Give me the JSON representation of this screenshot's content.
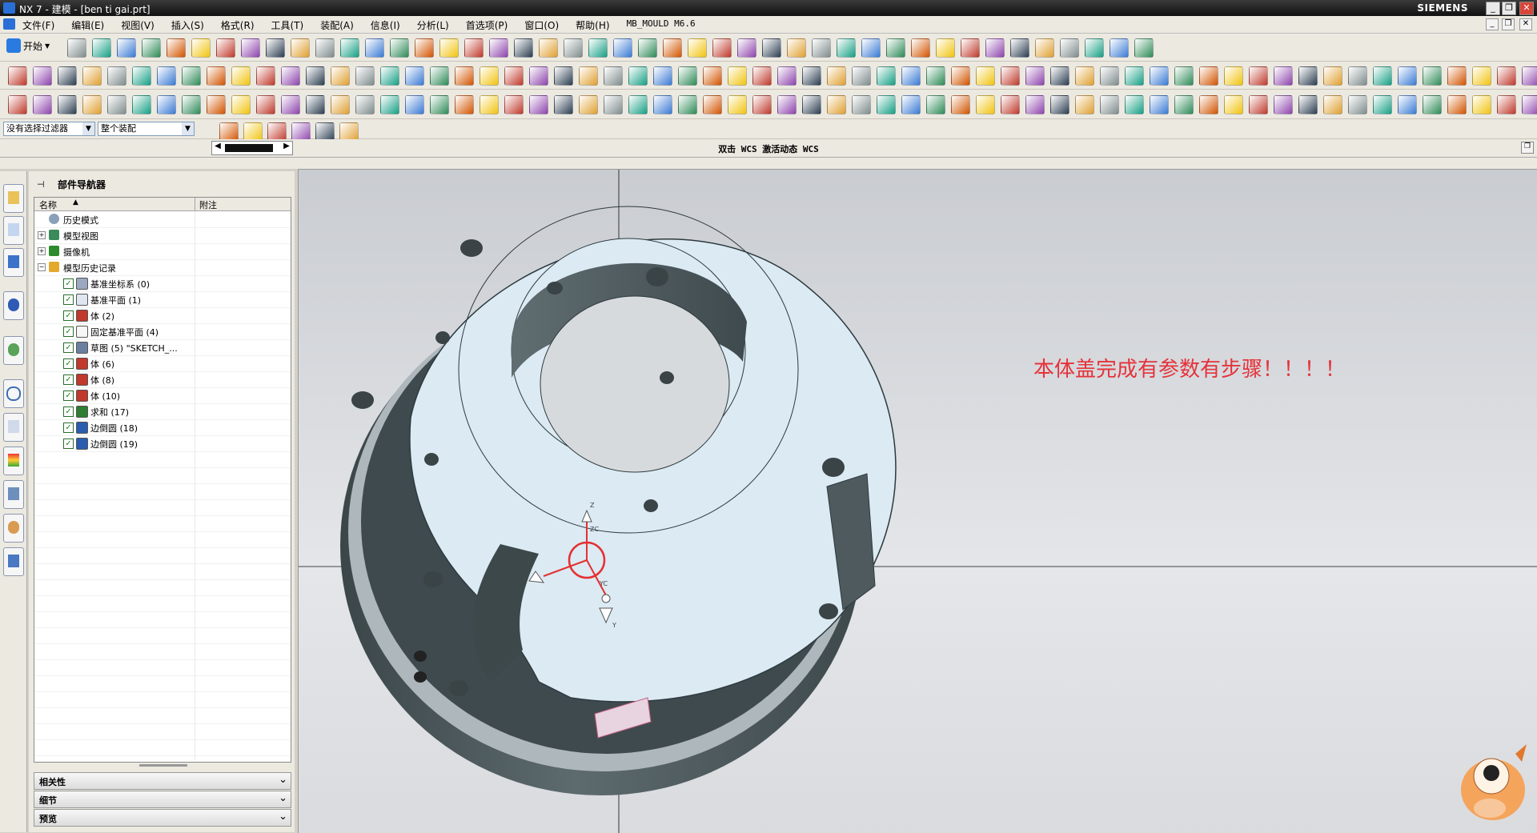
{
  "window": {
    "title": "NX 7 - 建模 - [ben ti gai.prt]",
    "brand": "SIEMENS",
    "controls": [
      "_",
      "❐",
      "✕"
    ]
  },
  "menu": {
    "items": [
      "文件(F)",
      "编辑(E)",
      "视图(V)",
      "插入(S)",
      "格式(R)",
      "工具(T)",
      "装配(A)",
      "信息(I)",
      "分析(L)",
      "首选项(P)",
      "窗口(O)",
      "帮助(H)",
      "MB_MOULD M6.6"
    ]
  },
  "toolbar": {
    "start_label": "开始"
  },
  "selection": {
    "filter_value": "没有选择过滤器",
    "scope_value": "整个装配"
  },
  "cue_line": "双击 WCS 激活动态 WCS",
  "navigator": {
    "title": "部件导航器",
    "col_name": "名称",
    "col_note": "附注",
    "rows": [
      {
        "label": "历史模式",
        "checked": false
      },
      {
        "label": "模型视图",
        "checked": false
      },
      {
        "label": "摄像机",
        "checked": false
      },
      {
        "label": "模型历史记录",
        "checked": false
      },
      {
        "label": "基准坐标系 (0)",
        "checked": true
      },
      {
        "label": "基准平面 (1)",
        "checked": true
      },
      {
        "label": "体 (2)",
        "checked": true
      },
      {
        "label": "固定基准平面 (4)",
        "checked": true
      },
      {
        "label": "草图 (5) \"SKETCH_...",
        "checked": true
      },
      {
        "label": "体 (6)",
        "checked": true
      },
      {
        "label": "体 (8)",
        "checked": true
      },
      {
        "label": "体 (10)",
        "checked": true
      },
      {
        "label": "求和 (17)",
        "checked": true
      },
      {
        "label": "边倒圆 (18)",
        "checked": true
      },
      {
        "label": "边倒圆 (19)",
        "checked": true
      }
    ],
    "sections": [
      "相关性",
      "细节",
      "预览"
    ]
  },
  "viewport": {
    "annotation": "本体盖完成有参数有步骤！！！！",
    "triad_labels": [
      "ZC",
      "YC",
      "Z",
      "Y"
    ]
  },
  "colors": {
    "part_face": "#dbeaf3",
    "part_side": "#4e5a5e",
    "annotation": "#e5333a",
    "triad": "#e53030"
  }
}
